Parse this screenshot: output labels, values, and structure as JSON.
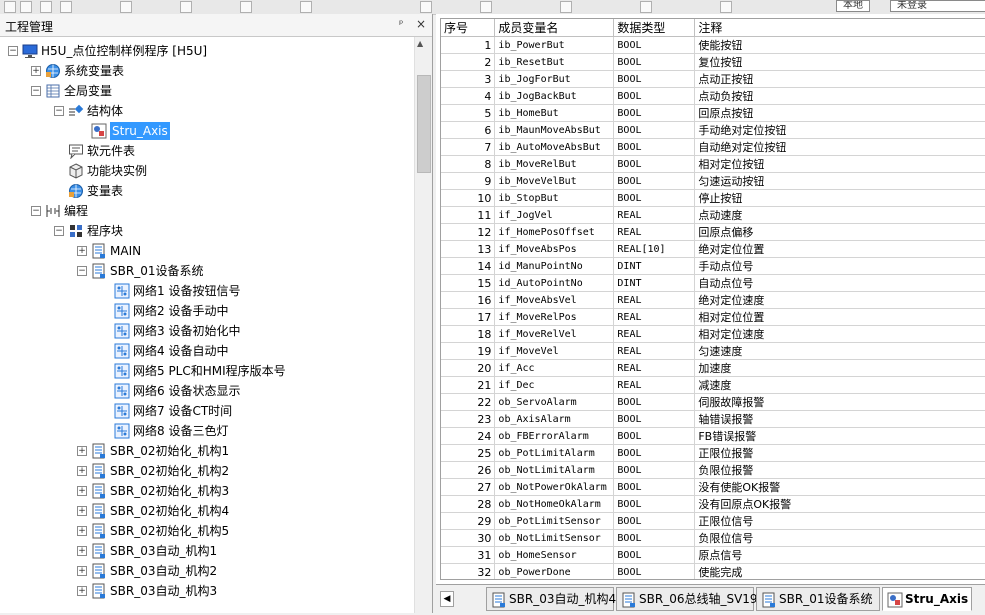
{
  "toolbar": {
    "button_1": "本地",
    "button_2": "未登录"
  },
  "project_panel": {
    "title": "工程管理",
    "pin_glyph": "ᵖ",
    "close_glyph": "×",
    "tree": [
      {
        "label": "H5U_点位控制样例程序 [H5U]",
        "icon": "monitor-icon",
        "exp": "−"
      },
      {
        "label": "系统变量表",
        "icon": "globe-icon",
        "exp": "+"
      },
      {
        "label": "全局变量",
        "icon": "table-icon",
        "exp": "−"
      },
      {
        "label": "结构体",
        "icon": "struct-icon",
        "exp": "−"
      },
      {
        "label": "Stru_Axis",
        "icon": "struct-item-icon",
        "exp": ""
      },
      {
        "label": "软元件表",
        "icon": "chat-icon",
        "exp": ""
      },
      {
        "label": "功能块实例",
        "icon": "cube-icon",
        "exp": ""
      },
      {
        "label": "变量表",
        "icon": "globe-icon",
        "exp": ""
      },
      {
        "label": "编程",
        "icon": "ladder-icon",
        "exp": "−"
      },
      {
        "label": "程序块",
        "icon": "blocks-icon",
        "exp": "−"
      },
      {
        "label": "MAIN",
        "icon": "program-icon",
        "exp": "+"
      },
      {
        "label": "SBR_01设备系统",
        "icon": "program-icon",
        "exp": "−"
      },
      {
        "label": "网络1 设备按钮信号",
        "icon": "network-icon",
        "exp": ""
      },
      {
        "label": "网络2 设备手动中",
        "icon": "network-icon",
        "exp": ""
      },
      {
        "label": "网络3 设备初始化中",
        "icon": "network-icon",
        "exp": ""
      },
      {
        "label": "网络4 设备自动中",
        "icon": "network-icon",
        "exp": ""
      },
      {
        "label": "网络5 PLC和HMI程序版本号",
        "icon": "network-icon",
        "exp": ""
      },
      {
        "label": "网络6 设备状态显示",
        "icon": "network-icon",
        "exp": ""
      },
      {
        "label": "网络7 设备CT时间",
        "icon": "network-icon",
        "exp": ""
      },
      {
        "label": "网络8 设备三色灯",
        "icon": "network-icon",
        "exp": ""
      },
      {
        "label": "SBR_02初始化_机构1",
        "icon": "program-icon",
        "exp": "+"
      },
      {
        "label": "SBR_02初始化_机构2",
        "icon": "program-icon",
        "exp": "+"
      },
      {
        "label": "SBR_02初始化_机构3",
        "icon": "program-icon",
        "exp": "+"
      },
      {
        "label": "SBR_02初始化_机构4",
        "icon": "program-icon",
        "exp": "+"
      },
      {
        "label": "SBR_02初始化_机构5",
        "icon": "program-icon",
        "exp": "+"
      },
      {
        "label": "SBR_03自动_机构1",
        "icon": "program-icon",
        "exp": "+"
      },
      {
        "label": "SBR_03自动_机构2",
        "icon": "program-icon",
        "exp": "+"
      },
      {
        "label": "SBR_03自动_机构3",
        "icon": "program-icon",
        "exp": "+"
      }
    ]
  },
  "struct_table": {
    "headers": [
      "序号",
      "成员变量名",
      "数据类型",
      "注释"
    ],
    "rows": [
      [
        "1",
        "ib_PowerBut",
        "BOOL",
        "使能按钮"
      ],
      [
        "2",
        "ib_ResetBut",
        "BOOL",
        "复位按钮"
      ],
      [
        "3",
        "ib_JogForBut",
        "BOOL",
        "点动正按钮"
      ],
      [
        "4",
        "ib_JogBackBut",
        "BOOL",
        "点动负按钮"
      ],
      [
        "5",
        "ib_HomeBut",
        "BOOL",
        "回原点按钮"
      ],
      [
        "6",
        "ib_MaunMoveAbsBut",
        "BOOL",
        "手动绝对定位按钮"
      ],
      [
        "7",
        "ib_AutoMoveAbsBut",
        "BOOL",
        "自动绝对定位按钮"
      ],
      [
        "8",
        "ib_MoveRelBut",
        "BOOL",
        "相对定位按钮"
      ],
      [
        "9",
        "ib_MoveVelBut",
        "BOOL",
        "匀速运动按钮"
      ],
      [
        "10",
        "ib_StopBut",
        "BOOL",
        "停止按钮"
      ],
      [
        "11",
        "if_JogVel",
        "REAL",
        "点动速度"
      ],
      [
        "12",
        "if_HomePosOffset",
        "REAL",
        "回原点偏移"
      ],
      [
        "13",
        "if_MoveAbsPos",
        "REAL[10]",
        "绝对定位位置"
      ],
      [
        "14",
        "id_ManuPointNo",
        "DINT",
        "手动点位号"
      ],
      [
        "15",
        "id_AutoPointNo",
        "DINT",
        "自动点位号"
      ],
      [
        "16",
        "if_MoveAbsVel",
        "REAL",
        "绝对定位速度"
      ],
      [
        "17",
        "if_MoveRelPos",
        "REAL",
        "相对定位位置"
      ],
      [
        "18",
        "if_MoveRelVel",
        "REAL",
        "相对定位速度"
      ],
      [
        "19",
        "if_MoveVel",
        "REAL",
        "匀速速度"
      ],
      [
        "20",
        "if_Acc",
        "REAL",
        "加速度"
      ],
      [
        "21",
        "if_Dec",
        "REAL",
        "减速度"
      ],
      [
        "22",
        "ob_ServoAlarm",
        "BOOL",
        "伺服故障报警"
      ],
      [
        "23",
        "ob_AxisAlarm",
        "BOOL",
        "轴错误报警"
      ],
      [
        "24",
        "ob_FBErrorAlarm",
        "BOOL",
        "FB错误报警"
      ],
      [
        "25",
        "ob_PotLimitAlarm",
        "BOOL",
        "正限位报警"
      ],
      [
        "26",
        "ob_NotLimitAlarm",
        "BOOL",
        "负限位报警"
      ],
      [
        "27",
        "ob_NotPowerOkAlarm",
        "BOOL",
        "没有使能OK报警"
      ],
      [
        "28",
        "ob_NotHomeOkAlarm",
        "BOOL",
        "没有回原点OK报警"
      ],
      [
        "29",
        "ob_PotLimitSensor",
        "BOOL",
        "正限位信号"
      ],
      [
        "30",
        "ob_NotLimitSensor",
        "BOOL",
        "负限位信号"
      ],
      [
        "31",
        "ob_HomeSensor",
        "BOOL",
        "原点信号"
      ],
      [
        "32",
        "ob_PowerDone",
        "BOOL",
        "使能完成"
      ]
    ]
  },
  "tabs": [
    {
      "label": "SBR_03自动_机构4",
      "active": false
    },
    {
      "label": "SBR_06总线轴_SV19",
      "active": false
    },
    {
      "label": "SBR_01设备系统",
      "active": false
    },
    {
      "label": "Stru_Axis",
      "active": true
    }
  ],
  "colors": {
    "selection": "#3399ff",
    "grid_line": "#d4d4d4"
  }
}
